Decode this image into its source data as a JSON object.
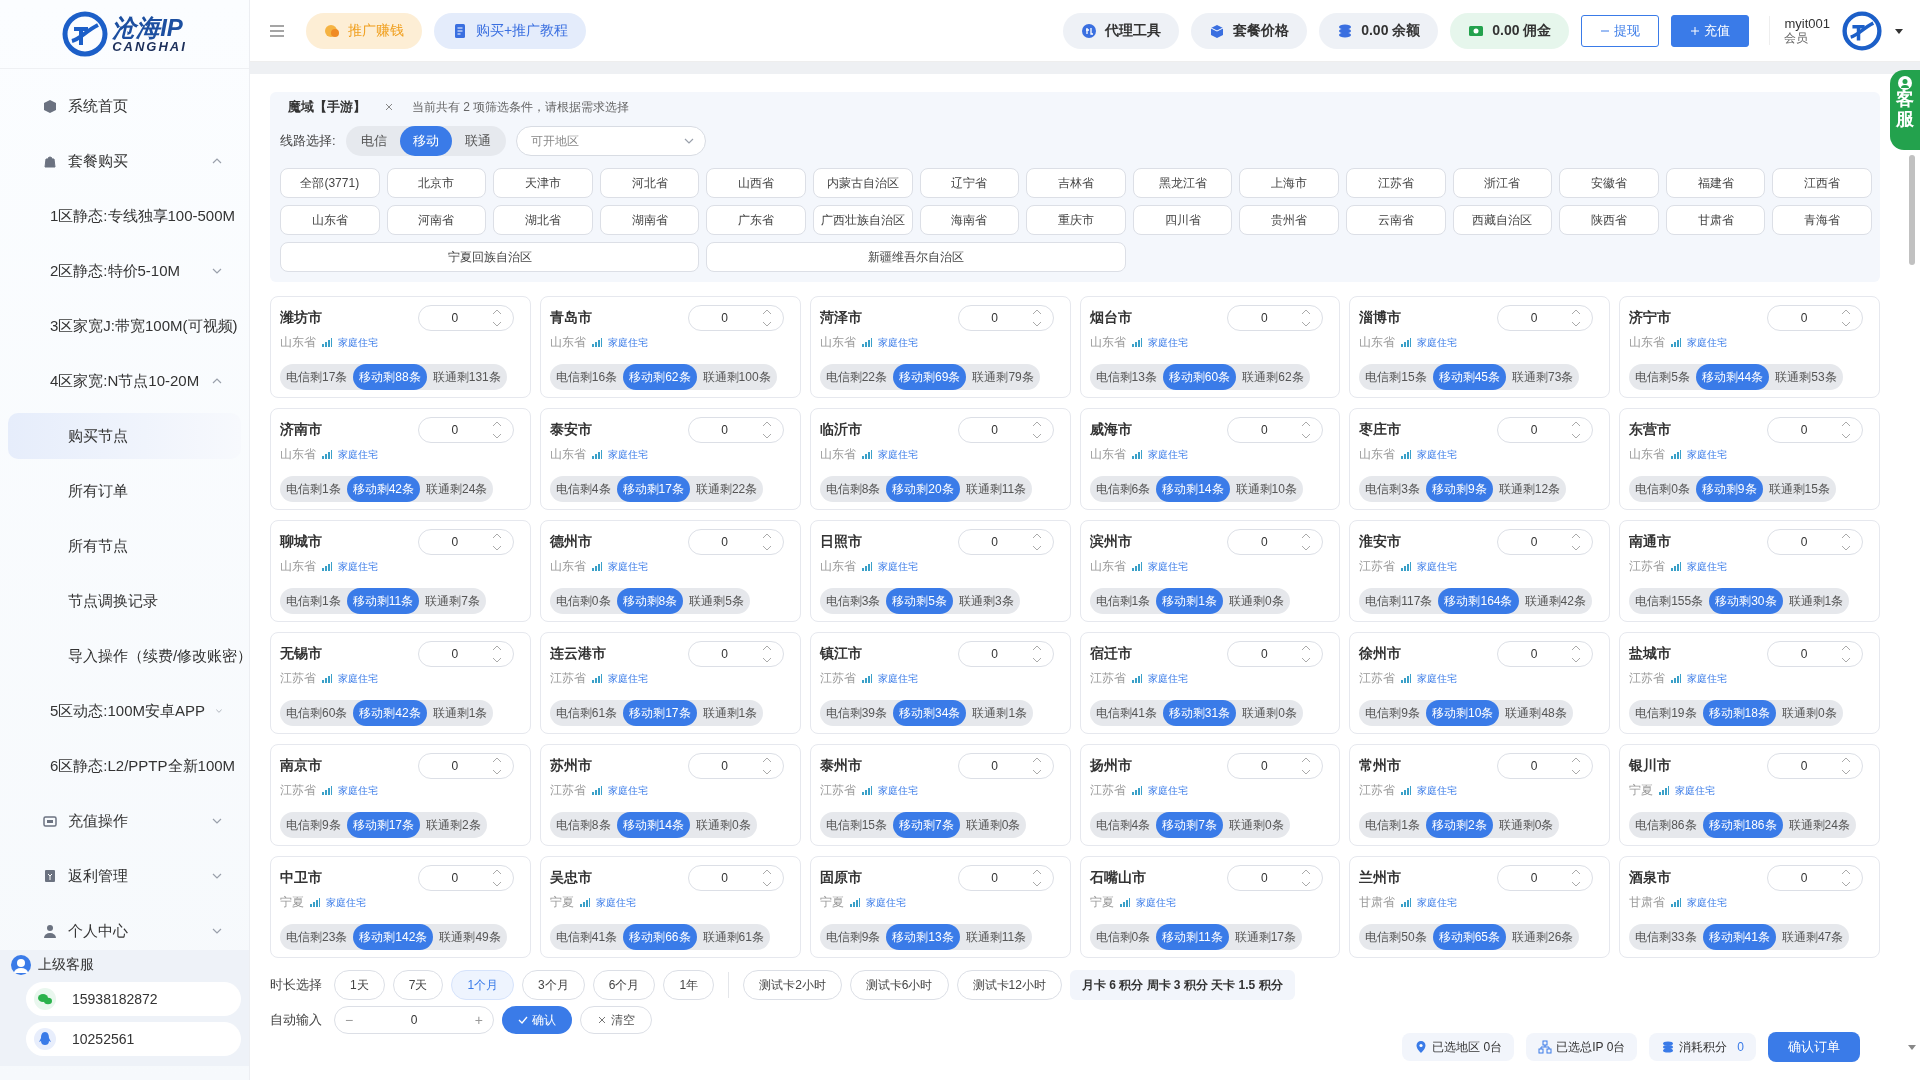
{
  "sidebar": {
    "logo": {
      "name": "沧海IP",
      "latin": "CANGHAI"
    },
    "items": [
      {
        "label": "系统首页",
        "selected": false
      },
      {
        "label": "套餐购买",
        "selected": false,
        "expanded": true,
        "children": [
          {
            "label": "1区静态:专线独享100-500M",
            "selected": false
          },
          {
            "label": "2区静态:特价5-10M",
            "selected": false,
            "expanded": false
          },
          {
            "label": "3区家宽J:带宽100M(可视频)",
            "selected": false
          },
          {
            "label": "4区家宽:N节点10-20M",
            "selected": false,
            "expanded": true,
            "children": [
              {
                "label": "购买节点",
                "selected": true
              },
              {
                "label": "所有订单",
                "selected": false
              },
              {
                "label": "所有节点",
                "selected": false
              },
              {
                "label": "节点调换记录",
                "selected": false
              },
              {
                "label": "导入操作（续费/修改账密）",
                "selected": false
              }
            ]
          },
          {
            "label": "5区动态:100M安卓APP",
            "selected": false,
            "expanded": false
          },
          {
            "label": "6区静态:L2/PPTP全新100M",
            "selected": false
          }
        ]
      },
      {
        "label": "充值操作",
        "selected": false,
        "expanded": false
      },
      {
        "label": "返利管理",
        "selected": false,
        "expanded": false
      },
      {
        "label": "个人中心",
        "selected": false,
        "expanded": false
      }
    ],
    "contact": {
      "title": "上级客服",
      "wechat": "15938182872",
      "qq": "10252561"
    }
  },
  "topbar": {
    "promo": "推广赚钱",
    "tutorial": "购买+推广教程",
    "agent_tools": "代理工具",
    "prices": "套餐价格",
    "balance": "0.00 余额",
    "commission": "0.00 佣金",
    "withdraw": "提现",
    "recharge": "充值",
    "user": {
      "name": "myit001",
      "role": "会员"
    }
  },
  "service_tab": {
    "label": "客服"
  },
  "filter": {
    "tag": "魔域【手游】",
    "hint": "当前共有 2 项筛选条件，请根据需求选择",
    "line_label": "线路选择:",
    "lines": [
      {
        "label": "电信",
        "selected": false
      },
      {
        "label": "移动",
        "selected": true
      },
      {
        "label": "联通",
        "selected": false
      }
    ],
    "region_select": {
      "placeholder": "可开地区"
    },
    "region_rows": [
      [
        "全部(3771)",
        "北京市",
        "天津市",
        "河北省",
        "山西省",
        "内蒙古自治区",
        "辽宁省",
        "吉林省",
        "黑龙江省",
        "上海市",
        "江苏省",
        "浙江省",
        "安徽省",
        "福建省",
        "江西省"
      ],
      [
        "山东省",
        "河南省",
        "湖北省",
        "湖南省",
        "广东省",
        "广西壮族自治区",
        "海南省",
        "重庆市",
        "四川省",
        "贵州省",
        "云南省",
        "西藏自治区",
        "陕西省",
        "甘肃省",
        "青海省"
      ],
      [
        "宁夏回族自治区",
        "新疆维吾尔自治区"
      ]
    ]
  },
  "cards": [
    {
      "city": "潍坊市",
      "province": "山东省",
      "tag": "家庭住宅",
      "quantity": "0",
      "stock": [
        {
          "label": "电信剩17条",
          "selected": false
        },
        {
          "label": "移动剩88条",
          "selected": true
        },
        {
          "label": "联通剩131条",
          "selected": false
        }
      ]
    },
    {
      "city": "青岛市",
      "province": "山东省",
      "tag": "家庭住宅",
      "quantity": "0",
      "stock": [
        {
          "label": "电信剩16条",
          "selected": false
        },
        {
          "label": "移动剩62条",
          "selected": true
        },
        {
          "label": "联通剩100条",
          "selected": false
        }
      ]
    },
    {
      "city": "菏泽市",
      "province": "山东省",
      "tag": "家庭住宅",
      "quantity": "0",
      "stock": [
        {
          "label": "电信剩22条",
          "selected": false
        },
        {
          "label": "移动剩69条",
          "selected": true
        },
        {
          "label": "联通剩79条",
          "selected": false
        }
      ]
    },
    {
      "city": "烟台市",
      "province": "山东省",
      "tag": "家庭住宅",
      "quantity": "0",
      "stock": [
        {
          "label": "电信剩13条",
          "selected": false
        },
        {
          "label": "移动剩60条",
          "selected": true
        },
        {
          "label": "联通剩62条",
          "selected": false
        }
      ]
    },
    {
      "city": "淄博市",
      "province": "山东省",
      "tag": "家庭住宅",
      "quantity": "0",
      "stock": [
        {
          "label": "电信剩15条",
          "selected": false
        },
        {
          "label": "移动剩45条",
          "selected": true
        },
        {
          "label": "联通剩73条",
          "selected": false
        }
      ]
    },
    {
      "city": "济宁市",
      "province": "山东省",
      "tag": "家庭住宅",
      "quantity": "0",
      "stock": [
        {
          "label": "电信剩5条",
          "selected": false
        },
        {
          "label": "移动剩44条",
          "selected": true
        },
        {
          "label": "联通剩53条",
          "selected": false
        }
      ]
    },
    {
      "city": "济南市",
      "province": "山东省",
      "tag": "家庭住宅",
      "quantity": "0",
      "stock": [
        {
          "label": "电信剩1条",
          "selected": false
        },
        {
          "label": "移动剩42条",
          "selected": true
        },
        {
          "label": "联通剩24条",
          "selected": false
        }
      ]
    },
    {
      "city": "泰安市",
      "province": "山东省",
      "tag": "家庭住宅",
      "quantity": "0",
      "stock": [
        {
          "label": "电信剩4条",
          "selected": false
        },
        {
          "label": "移动剩17条",
          "selected": true
        },
        {
          "label": "联通剩22条",
          "selected": false
        }
      ]
    },
    {
      "city": "临沂市",
      "province": "山东省",
      "tag": "家庭住宅",
      "quantity": "0",
      "stock": [
        {
          "label": "电信剩8条",
          "selected": false
        },
        {
          "label": "移动剩20条",
          "selected": true
        },
        {
          "label": "联通剩11条",
          "selected": false
        }
      ]
    },
    {
      "city": "威海市",
      "province": "山东省",
      "tag": "家庭住宅",
      "quantity": "0",
      "stock": [
        {
          "label": "电信剩6条",
          "selected": false
        },
        {
          "label": "移动剩14条",
          "selected": true
        },
        {
          "label": "联通剩10条",
          "selected": false
        }
      ]
    },
    {
      "city": "枣庄市",
      "province": "山东省",
      "tag": "家庭住宅",
      "quantity": "0",
      "stock": [
        {
          "label": "电信剩3条",
          "selected": false
        },
        {
          "label": "移动剩9条",
          "selected": true
        },
        {
          "label": "联通剩12条",
          "selected": false
        }
      ]
    },
    {
      "city": "东营市",
      "province": "山东省",
      "tag": "家庭住宅",
      "quantity": "0",
      "stock": [
        {
          "label": "电信剩0条",
          "selected": false
        },
        {
          "label": "移动剩9条",
          "selected": true
        },
        {
          "label": "联通剩15条",
          "selected": false
        }
      ]
    },
    {
      "city": "聊城市",
      "province": "山东省",
      "tag": "家庭住宅",
      "quantity": "0",
      "stock": [
        {
          "label": "电信剩1条",
          "selected": false
        },
        {
          "label": "移动剩11条",
          "selected": true
        },
        {
          "label": "联通剩7条",
          "selected": false
        }
      ]
    },
    {
      "city": "德州市",
      "province": "山东省",
      "tag": "家庭住宅",
      "quantity": "0",
      "stock": [
        {
          "label": "电信剩0条",
          "selected": false
        },
        {
          "label": "移动剩8条",
          "selected": true
        },
        {
          "label": "联通剩5条",
          "selected": false
        }
      ]
    },
    {
      "city": "日照市",
      "province": "山东省",
      "tag": "家庭住宅",
      "quantity": "0",
      "stock": [
        {
          "label": "电信剩3条",
          "selected": false
        },
        {
          "label": "移动剩5条",
          "selected": true
        },
        {
          "label": "联通剩3条",
          "selected": false
        }
      ]
    },
    {
      "city": "滨州市",
      "province": "山东省",
      "tag": "家庭住宅",
      "quantity": "0",
      "stock": [
        {
          "label": "电信剩1条",
          "selected": false
        },
        {
          "label": "移动剩1条",
          "selected": true
        },
        {
          "label": "联通剩0条",
          "selected": false
        }
      ]
    },
    {
      "city": "淮安市",
      "province": "江苏省",
      "tag": "家庭住宅",
      "quantity": "0",
      "stock": [
        {
          "label": "电信剩117条",
          "selected": false
        },
        {
          "label": "移动剩164条",
          "selected": true
        },
        {
          "label": "联通剩42条",
          "selected": false
        }
      ]
    },
    {
      "city": "南通市",
      "province": "江苏省",
      "tag": "家庭住宅",
      "quantity": "0",
      "stock": [
        {
          "label": "电信剩155条",
          "selected": false
        },
        {
          "label": "移动剩30条",
          "selected": true
        },
        {
          "label": "联通剩1条",
          "selected": false
        }
      ]
    },
    {
      "city": "无锡市",
      "province": "江苏省",
      "tag": "家庭住宅",
      "quantity": "0",
      "stock": [
        {
          "label": "电信剩60条",
          "selected": false
        },
        {
          "label": "移动剩42条",
          "selected": true
        },
        {
          "label": "联通剩1条",
          "selected": false
        }
      ]
    },
    {
      "city": "连云港市",
      "province": "江苏省",
      "tag": "家庭住宅",
      "quantity": "0",
      "stock": [
        {
          "label": "电信剩61条",
          "selected": false
        },
        {
          "label": "移动剩17条",
          "selected": true
        },
        {
          "label": "联通剩1条",
          "selected": false
        }
      ]
    },
    {
      "city": "镇江市",
      "province": "江苏省",
      "tag": "家庭住宅",
      "quantity": "0",
      "stock": [
        {
          "label": "电信剩39条",
          "selected": false
        },
        {
          "label": "移动剩34条",
          "selected": true
        },
        {
          "label": "联通剩1条",
          "selected": false
        }
      ]
    },
    {
      "city": "宿迁市",
      "province": "江苏省",
      "tag": "家庭住宅",
      "quantity": "0",
      "stock": [
        {
          "label": "电信剩41条",
          "selected": false
        },
        {
          "label": "移动剩31条",
          "selected": true
        },
        {
          "label": "联通剩0条",
          "selected": false
        }
      ]
    },
    {
      "city": "徐州市",
      "province": "江苏省",
      "tag": "家庭住宅",
      "quantity": "0",
      "stock": [
        {
          "label": "电信剩9条",
          "selected": false
        },
        {
          "label": "移动剩10条",
          "selected": true
        },
        {
          "label": "联通剩48条",
          "selected": false
        }
      ]
    },
    {
      "city": "盐城市",
      "province": "江苏省",
      "tag": "家庭住宅",
      "quantity": "0",
      "stock": [
        {
          "label": "电信剩19条",
          "selected": false
        },
        {
          "label": "移动剩18条",
          "selected": true
        },
        {
          "label": "联通剩0条",
          "selected": false
        }
      ]
    },
    {
      "city": "南京市",
      "province": "江苏省",
      "tag": "家庭住宅",
      "quantity": "0",
      "stock": [
        {
          "label": "电信剩9条",
          "selected": false
        },
        {
          "label": "移动剩17条",
          "selected": true
        },
        {
          "label": "联通剩2条",
          "selected": false
        }
      ]
    },
    {
      "city": "苏州市",
      "province": "江苏省",
      "tag": "家庭住宅",
      "quantity": "0",
      "stock": [
        {
          "label": "电信剩8条",
          "selected": false
        },
        {
          "label": "移动剩14条",
          "selected": true
        },
        {
          "label": "联通剩0条",
          "selected": false
        }
      ]
    },
    {
      "city": "泰州市",
      "province": "江苏省",
      "tag": "家庭住宅",
      "quantity": "0",
      "stock": [
        {
          "label": "电信剩15条",
          "selected": false
        },
        {
          "label": "移动剩7条",
          "selected": true
        },
        {
          "label": "联通剩0条",
          "selected": false
        }
      ]
    },
    {
      "city": "扬州市",
      "province": "江苏省",
      "tag": "家庭住宅",
      "quantity": "0",
      "stock": [
        {
          "label": "电信剩4条",
          "selected": false
        },
        {
          "label": "移动剩7条",
          "selected": true
        },
        {
          "label": "联通剩0条",
          "selected": false
        }
      ]
    },
    {
      "city": "常州市",
      "province": "江苏省",
      "tag": "家庭住宅",
      "quantity": "0",
      "stock": [
        {
          "label": "电信剩1条",
          "selected": false
        },
        {
          "label": "移动剩2条",
          "selected": true
        },
        {
          "label": "联通剩0条",
          "selected": false
        }
      ]
    },
    {
      "city": "银川市",
      "province": "宁夏",
      "tag": "家庭住宅",
      "quantity": "0",
      "stock": [
        {
          "label": "电信剩86条",
          "selected": false
        },
        {
          "label": "移动剩186条",
          "selected": true
        },
        {
          "label": "联通剩24条",
          "selected": false
        }
      ]
    },
    {
      "city": "中卫市",
      "province": "宁夏",
      "tag": "家庭住宅",
      "quantity": "0",
      "stock": [
        {
          "label": "电信剩23条",
          "selected": false
        },
        {
          "label": "移动剩142条",
          "selected": true
        },
        {
          "label": "联通剩49条",
          "selected": false
        }
      ]
    },
    {
      "city": "吴忠市",
      "province": "宁夏",
      "tag": "家庭住宅",
      "quantity": "0",
      "stock": [
        {
          "label": "电信剩41条",
          "selected": false
        },
        {
          "label": "移动剩66条",
          "selected": true
        },
        {
          "label": "联通剩61条",
          "selected": false
        }
      ]
    },
    {
      "city": "固原市",
      "province": "宁夏",
      "tag": "家庭住宅",
      "quantity": "0",
      "stock": [
        {
          "label": "电信剩9条",
          "selected": false
        },
        {
          "label": "移动剩13条",
          "selected": true
        },
        {
          "label": "联通剩11条",
          "selected": false
        }
      ]
    },
    {
      "city": "石嘴山市",
      "province": "宁夏",
      "tag": "家庭住宅",
      "quantity": "0",
      "stock": [
        {
          "label": "电信剩0条",
          "selected": false
        },
        {
          "label": "移动剩11条",
          "selected": true
        },
        {
          "label": "联通剩17条",
          "selected": false
        }
      ]
    },
    {
      "city": "兰州市",
      "province": "甘肃省",
      "tag": "家庭住宅",
      "quantity": "0",
      "stock": [
        {
          "label": "电信剩50条",
          "selected": false
        },
        {
          "label": "移动剩65条",
          "selected": true
        },
        {
          "label": "联通剩26条",
          "selected": false
        }
      ]
    },
    {
      "city": "酒泉市",
      "province": "甘肃省",
      "tag": "家庭住宅",
      "quantity": "0",
      "stock": [
        {
          "label": "电信剩33条",
          "selected": false
        },
        {
          "label": "移动剩41条",
          "selected": true
        },
        {
          "label": "联通剩47条",
          "selected": false
        }
      ]
    }
  ],
  "duration": {
    "label": "时长选择",
    "options": [
      {
        "label": "1天",
        "selected": false
      },
      {
        "label": "7天",
        "selected": false
      },
      {
        "label": "1个月",
        "selected": true
      },
      {
        "label": "3个月",
        "selected": false
      },
      {
        "label": "6个月",
        "selected": false
      },
      {
        "label": "1年",
        "selected": false
      }
    ],
    "trials": [
      {
        "label": "测试卡2小时",
        "selected": false
      },
      {
        "label": "测试卡6小时",
        "selected": false
      },
      {
        "label": "测试卡12小时",
        "selected": false
      }
    ],
    "note": "月卡 6 积分 周卡 3 积分 天卡 1.5 积分"
  },
  "auto_input": {
    "label": "自动输入",
    "minus": "−",
    "value": "0",
    "plus": "+",
    "confirm": "确认",
    "clear": "清空"
  },
  "summary": {
    "regions": "已选地区 0台",
    "ips": "已选总IP 0台",
    "points_label": "消耗积分",
    "points": "0",
    "submit": "确认订单"
  }
}
